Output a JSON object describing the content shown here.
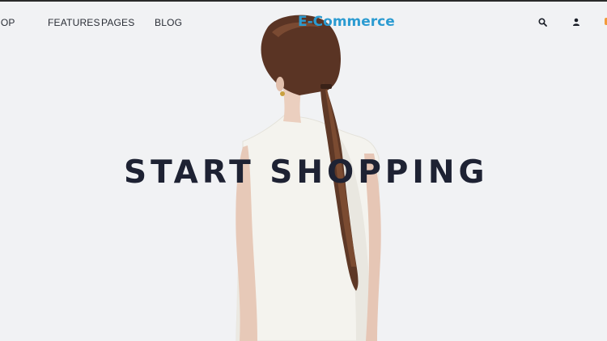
{
  "nav": {
    "shop_label": "HOP",
    "features_label": "FEATURES",
    "pages_label": "PAGES",
    "blog_label": "BLOG"
  },
  "brand": {
    "name": "E-Commerce",
    "color": "#2b9bd1"
  },
  "header_icons": [
    "search-icon",
    "user-icon",
    "cart-icon"
  ],
  "hero": {
    "title": "START SHOPPING",
    "title_color": "#1e2233"
  },
  "colors": {
    "background": "#f1f2f4",
    "cart_accent": "#f29b3b"
  }
}
